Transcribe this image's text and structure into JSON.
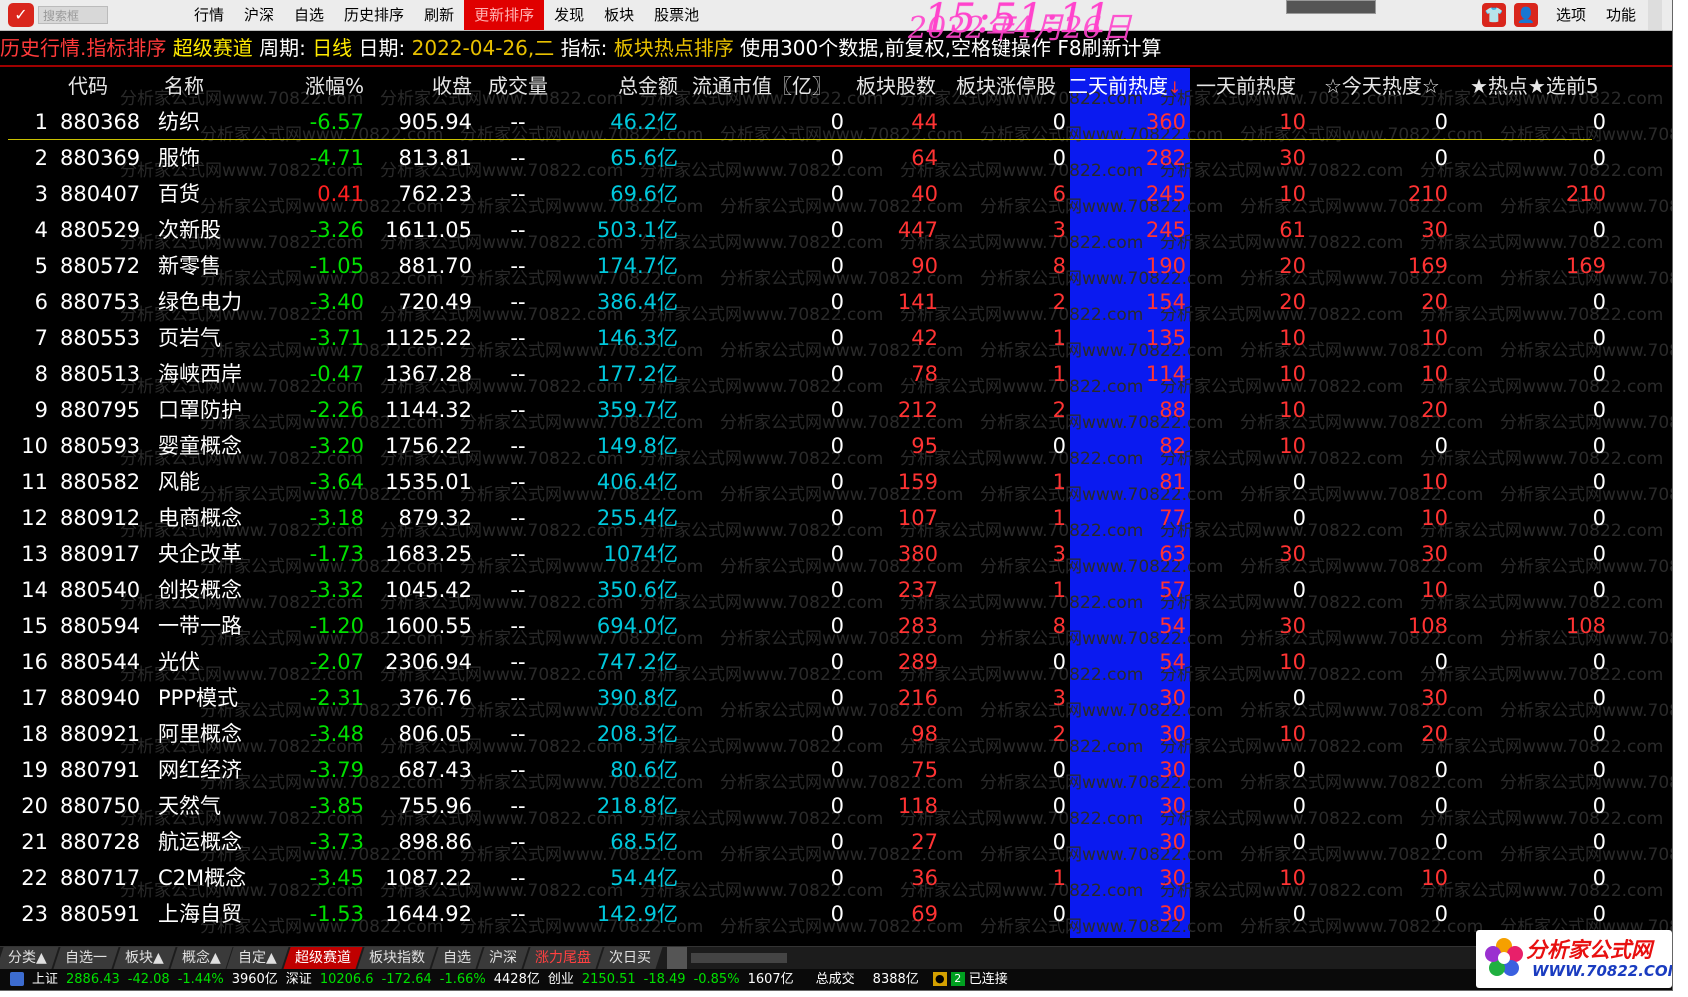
{
  "menu": {
    "search_placeholder": "搜索框",
    "items": [
      "行情",
      "沪深",
      "自选",
      "历史排序",
      "刷新",
      "更新排序",
      "发现",
      "板块",
      "股票池"
    ],
    "active_index": 5,
    "right": {
      "option_label": "选项",
      "function_label": "功能"
    }
  },
  "clock": "15:51:11",
  "info_bar": {
    "part1": "历史行情.指标排序",
    "part2": "超级赛道",
    "period_label": "周期:",
    "period_value": "日线",
    "date_label": "日期:",
    "date_value": "2022-04-26,二",
    "indicator_label": "指标:",
    "indicator_value": "板块热点排序",
    "note": "使用300个数据,前复权,空格键操作 F8刷新计算",
    "date_stamp": "2022年4月26日"
  },
  "table": {
    "headers": {
      "idx": "",
      "code": "代码",
      "name": "名称",
      "chg": "涨幅%",
      "close": "收盘",
      "vol": "成交量",
      "amt": "总金额",
      "mktv": "流通市值〖亿〗",
      "cnt": "板块股数",
      "lim": "板块涨停股",
      "h2": "二天前热度",
      "h2_sort": "↓",
      "h1": "一天前热度",
      "ht": "☆今天热度☆",
      "t5": "★热点★选前5"
    },
    "rows": [
      {
        "idx": "1",
        "code": "880368",
        "name": "纺织",
        "chg": "-6.57",
        "close": "905.94",
        "vol": "--",
        "amt": "46.2亿",
        "mktv": "0",
        "cnt": "44",
        "lim": "0",
        "h2": "360",
        "h1": "10",
        "ht": "0",
        "t5": "0"
      },
      {
        "idx": "2",
        "code": "880369",
        "name": "服饰",
        "chg": "-4.71",
        "close": "813.81",
        "vol": "--",
        "amt": "65.6亿",
        "mktv": "0",
        "cnt": "64",
        "lim": "0",
        "h2": "282",
        "h1": "30",
        "ht": "0",
        "t5": "0"
      },
      {
        "idx": "3",
        "code": "880407",
        "name": "百货",
        "chg": "0.41",
        "close": "762.23",
        "vol": "--",
        "amt": "69.6亿",
        "mktv": "0",
        "cnt": "40",
        "lim": "6",
        "h2": "245",
        "h1": "10",
        "ht": "210",
        "t5": "210"
      },
      {
        "idx": "4",
        "code": "880529",
        "name": "次新股",
        "chg": "-3.26",
        "close": "1611.05",
        "vol": "--",
        "amt": "503.1亿",
        "mktv": "0",
        "cnt": "447",
        "lim": "3",
        "h2": "245",
        "h1": "61",
        "ht": "30",
        "t5": "0"
      },
      {
        "idx": "5",
        "code": "880572",
        "name": "新零售",
        "chg": "-1.05",
        "close": "881.70",
        "vol": "--",
        "amt": "174.7亿",
        "mktv": "0",
        "cnt": "90",
        "lim": "8",
        "h2": "190",
        "h1": "20",
        "ht": "169",
        "t5": "169"
      },
      {
        "idx": "6",
        "code": "880753",
        "name": "绿色电力",
        "chg": "-3.40",
        "close": "720.49",
        "vol": "--",
        "amt": "386.4亿",
        "mktv": "0",
        "cnt": "141",
        "lim": "2",
        "h2": "154",
        "h1": "20",
        "ht": "20",
        "t5": "0"
      },
      {
        "idx": "7",
        "code": "880553",
        "name": "页岩气",
        "chg": "-3.71",
        "close": "1125.22",
        "vol": "--",
        "amt": "146.3亿",
        "mktv": "0",
        "cnt": "42",
        "lim": "1",
        "h2": "135",
        "h1": "10",
        "ht": "10",
        "t5": "0"
      },
      {
        "idx": "8",
        "code": "880513",
        "name": "海峡西岸",
        "chg": "-0.47",
        "close": "1367.28",
        "vol": "--",
        "amt": "177.2亿",
        "mktv": "0",
        "cnt": "78",
        "lim": "1",
        "h2": "114",
        "h1": "10",
        "ht": "10",
        "t5": "0"
      },
      {
        "idx": "9",
        "code": "880795",
        "name": "口罩防护",
        "chg": "-2.26",
        "close": "1144.32",
        "vol": "--",
        "amt": "359.7亿",
        "mktv": "0",
        "cnt": "212",
        "lim": "2",
        "h2": "88",
        "h1": "10",
        "ht": "20",
        "t5": "0"
      },
      {
        "idx": "10",
        "code": "880593",
        "name": "婴童概念",
        "chg": "-3.20",
        "close": "1756.22",
        "vol": "--",
        "amt": "149.8亿",
        "mktv": "0",
        "cnt": "95",
        "lim": "0",
        "h2": "82",
        "h1": "10",
        "ht": "0",
        "t5": "0"
      },
      {
        "idx": "11",
        "code": "880582",
        "name": "风能",
        "chg": "-3.64",
        "close": "1535.01",
        "vol": "--",
        "amt": "406.4亿",
        "mktv": "0",
        "cnt": "159",
        "lim": "1",
        "h2": "81",
        "h1": "0",
        "ht": "10",
        "t5": "0"
      },
      {
        "idx": "12",
        "code": "880912",
        "name": "电商概念",
        "chg": "-3.18",
        "close": "879.32",
        "vol": "--",
        "amt": "255.4亿",
        "mktv": "0",
        "cnt": "107",
        "lim": "1",
        "h2": "77",
        "h1": "0",
        "ht": "10",
        "t5": "0"
      },
      {
        "idx": "13",
        "code": "880917",
        "name": "央企改革",
        "chg": "-1.73",
        "close": "1683.25",
        "vol": "--",
        "amt": "1074亿",
        "mktv": "0",
        "cnt": "380",
        "lim": "3",
        "h2": "63",
        "h1": "30",
        "ht": "30",
        "t5": "0"
      },
      {
        "idx": "14",
        "code": "880540",
        "name": "创投概念",
        "chg": "-3.32",
        "close": "1045.42",
        "vol": "--",
        "amt": "350.6亿",
        "mktv": "0",
        "cnt": "237",
        "lim": "1",
        "h2": "57",
        "h1": "0",
        "ht": "10",
        "t5": "0"
      },
      {
        "idx": "15",
        "code": "880594",
        "name": "一带一路",
        "chg": "-1.20",
        "close": "1600.55",
        "vol": "--",
        "amt": "694.0亿",
        "mktv": "0",
        "cnt": "283",
        "lim": "8",
        "h2": "54",
        "h1": "30",
        "ht": "108",
        "t5": "108"
      },
      {
        "idx": "16",
        "code": "880544",
        "name": "光伏",
        "chg": "-2.07",
        "close": "2306.94",
        "vol": "--",
        "amt": "747.2亿",
        "mktv": "0",
        "cnt": "289",
        "lim": "0",
        "h2": "54",
        "h1": "10",
        "ht": "0",
        "t5": "0"
      },
      {
        "idx": "17",
        "code": "880940",
        "name": "PPP模式",
        "chg": "-2.31",
        "close": "376.76",
        "vol": "--",
        "amt": "390.8亿",
        "mktv": "0",
        "cnt": "216",
        "lim": "3",
        "h2": "30",
        "h1": "0",
        "ht": "30",
        "t5": "0"
      },
      {
        "idx": "18",
        "code": "880921",
        "name": "阿里概念",
        "chg": "-3.48",
        "close": "806.05",
        "vol": "--",
        "amt": "208.3亿",
        "mktv": "0",
        "cnt": "98",
        "lim": "2",
        "h2": "30",
        "h1": "10",
        "ht": "20",
        "t5": "0"
      },
      {
        "idx": "19",
        "code": "880791",
        "name": "网红经济",
        "chg": "-3.79",
        "close": "687.43",
        "vol": "--",
        "amt": "80.6亿",
        "mktv": "0",
        "cnt": "75",
        "lim": "0",
        "h2": "30",
        "h1": "0",
        "ht": "0",
        "t5": "0"
      },
      {
        "idx": "20",
        "code": "880750",
        "name": "天然气",
        "chg": "-3.85",
        "close": "755.96",
        "vol": "--",
        "amt": "218.8亿",
        "mktv": "0",
        "cnt": "118",
        "lim": "0",
        "h2": "30",
        "h1": "0",
        "ht": "0",
        "t5": "0"
      },
      {
        "idx": "21",
        "code": "880728",
        "name": "航运概念",
        "chg": "-3.73",
        "close": "898.86",
        "vol": "--",
        "amt": "68.5亿",
        "mktv": "0",
        "cnt": "27",
        "lim": "0",
        "h2": "30",
        "h1": "0",
        "ht": "0",
        "t5": "0"
      },
      {
        "idx": "22",
        "code": "880717",
        "name": "C2M概念",
        "chg": "-3.45",
        "close": "1087.22",
        "vol": "--",
        "amt": "54.4亿",
        "mktv": "0",
        "cnt": "36",
        "lim": "1",
        "h2": "30",
        "h1": "10",
        "ht": "10",
        "t5": "0"
      },
      {
        "idx": "23",
        "code": "880591",
        "name": "上海自贸",
        "chg": "-1.53",
        "close": "1644.92",
        "vol": "--",
        "amt": "142.9亿",
        "mktv": "0",
        "cnt": "69",
        "lim": "0",
        "h2": "30",
        "h1": "0",
        "ht": "0",
        "t5": "0"
      }
    ]
  },
  "watermark": "分析家公式网www.70822.com",
  "tabs": [
    {
      "label": "分类▲",
      "state": "normal"
    },
    {
      "label": "自选一",
      "state": "normal"
    },
    {
      "label": "板块▲",
      "state": "normal"
    },
    {
      "label": "概念▲",
      "state": "normal"
    },
    {
      "label": "自定▲",
      "state": "normal"
    },
    {
      "label": "超级赛道",
      "state": "active"
    },
    {
      "label": "板块指数",
      "state": "normal"
    },
    {
      "label": "自选",
      "state": "normal"
    },
    {
      "label": "沪深",
      "state": "normal"
    },
    {
      "label": "涨力尾盘",
      "state": "red"
    },
    {
      "label": "次日买",
      "state": "normal"
    }
  ],
  "status": {
    "sh_label": "上证",
    "sh_price": "2886.43",
    "sh_chg": "-42.08",
    "sh_pct": "-1.44%",
    "sh_amt": "3960亿",
    "sz_label": "深证",
    "sz_price": "10206.6",
    "sz_chg": "-172.64",
    "sz_pct": "-1.66%",
    "sz_amt": "4428亿",
    "cy_label": "创业",
    "cy_price": "2150.51",
    "cy_chg": "-18.49",
    "cy_pct": "-0.85%",
    "cy_amt": "1607亿",
    "total_label": "总成交",
    "total_amt": "8388亿",
    "badge_2": "2",
    "connected": "已连接"
  },
  "brand": {
    "cn": "分析家公式网",
    "url": "WWW.70822.COM"
  },
  "colors": {
    "highlight_column": "#0a1af0",
    "negative": "#00e000",
    "positive": "#ff2020",
    "amount": "#00c8dc",
    "active_tab": "#c00000"
  }
}
